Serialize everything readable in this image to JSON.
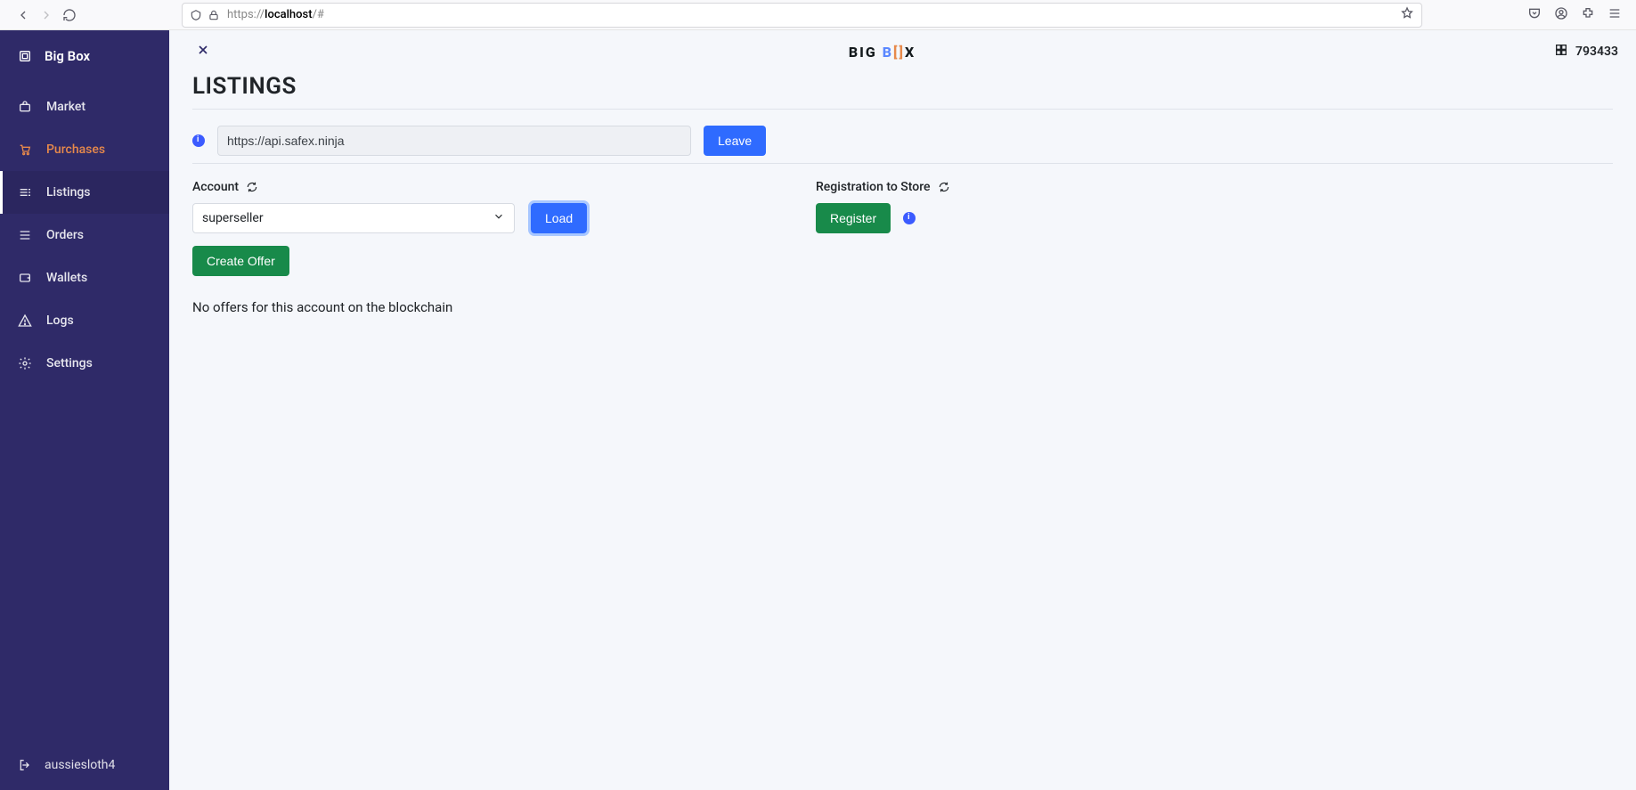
{
  "browser": {
    "url_prefix": "https://",
    "url_host": "localhost",
    "url_rest": "/#"
  },
  "sidebar": {
    "title": "Big Box",
    "items": [
      {
        "label": "Market",
        "icon": "briefcase",
        "key": "market"
      },
      {
        "label": "Purchases",
        "icon": "cart",
        "key": "purchases"
      },
      {
        "label": "Listings",
        "icon": "listings",
        "key": "listings"
      },
      {
        "label": "Orders",
        "icon": "stack",
        "key": "orders"
      },
      {
        "label": "Wallets",
        "icon": "wallet",
        "key": "wallets"
      },
      {
        "label": "Logs",
        "icon": "alert",
        "key": "logs"
      },
      {
        "label": "Settings",
        "icon": "gear",
        "key": "settings"
      }
    ],
    "user": "aussiesloth4"
  },
  "toolbar": {
    "logo": {
      "big": "BIG",
      "b": "B",
      "bracket_l": "[",
      "bracket_r": "]",
      "x": "X"
    },
    "block_count": "793433"
  },
  "main": {
    "heading": "LISTINGS",
    "api_url": "https://api.safex.ninja",
    "leave_label": "Leave",
    "account_label": "Account",
    "register_label": "Registration to Store",
    "account_value": "superseller",
    "load_label": "Load",
    "register_btn": "Register",
    "create_offer": "Create Offer",
    "no_offers": "No offers for this account on the blockchain"
  }
}
